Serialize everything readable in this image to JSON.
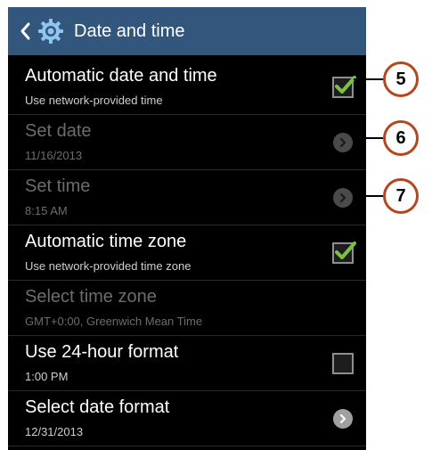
{
  "header": {
    "title": "Date and time",
    "back_icon": "chevron-left-icon",
    "settings_icon": "gear-icon",
    "background": "#33567d"
  },
  "rows": [
    {
      "title": "Automatic date and time",
      "subtitle": "Use network-provided time",
      "control": "checkbox",
      "checked": true,
      "enabled": true
    },
    {
      "title": "Set date",
      "subtitle": "11/16/2013",
      "control": "chevron",
      "enabled": false
    },
    {
      "title": "Set time",
      "subtitle": "8:15 AM",
      "control": "chevron",
      "enabled": false
    },
    {
      "title": "Automatic time zone",
      "subtitle": "Use network-provided time zone",
      "control": "checkbox",
      "checked": true,
      "enabled": true
    },
    {
      "title": "Select time zone",
      "subtitle": "GMT+0:00, Greenwich Mean Time",
      "control": "none",
      "enabled": false
    },
    {
      "title": "Use 24-hour format",
      "subtitle": "1:00 PM",
      "control": "checkbox",
      "checked": false,
      "enabled": true
    },
    {
      "title": "Select date format",
      "subtitle": "12/31/2013",
      "control": "chevron",
      "enabled": true
    }
  ],
  "callouts": [
    {
      "number": "5"
    },
    {
      "number": "6"
    },
    {
      "number": "7"
    }
  ],
  "colors": {
    "check": "#7cc242",
    "callout_border": "#b5461e"
  }
}
